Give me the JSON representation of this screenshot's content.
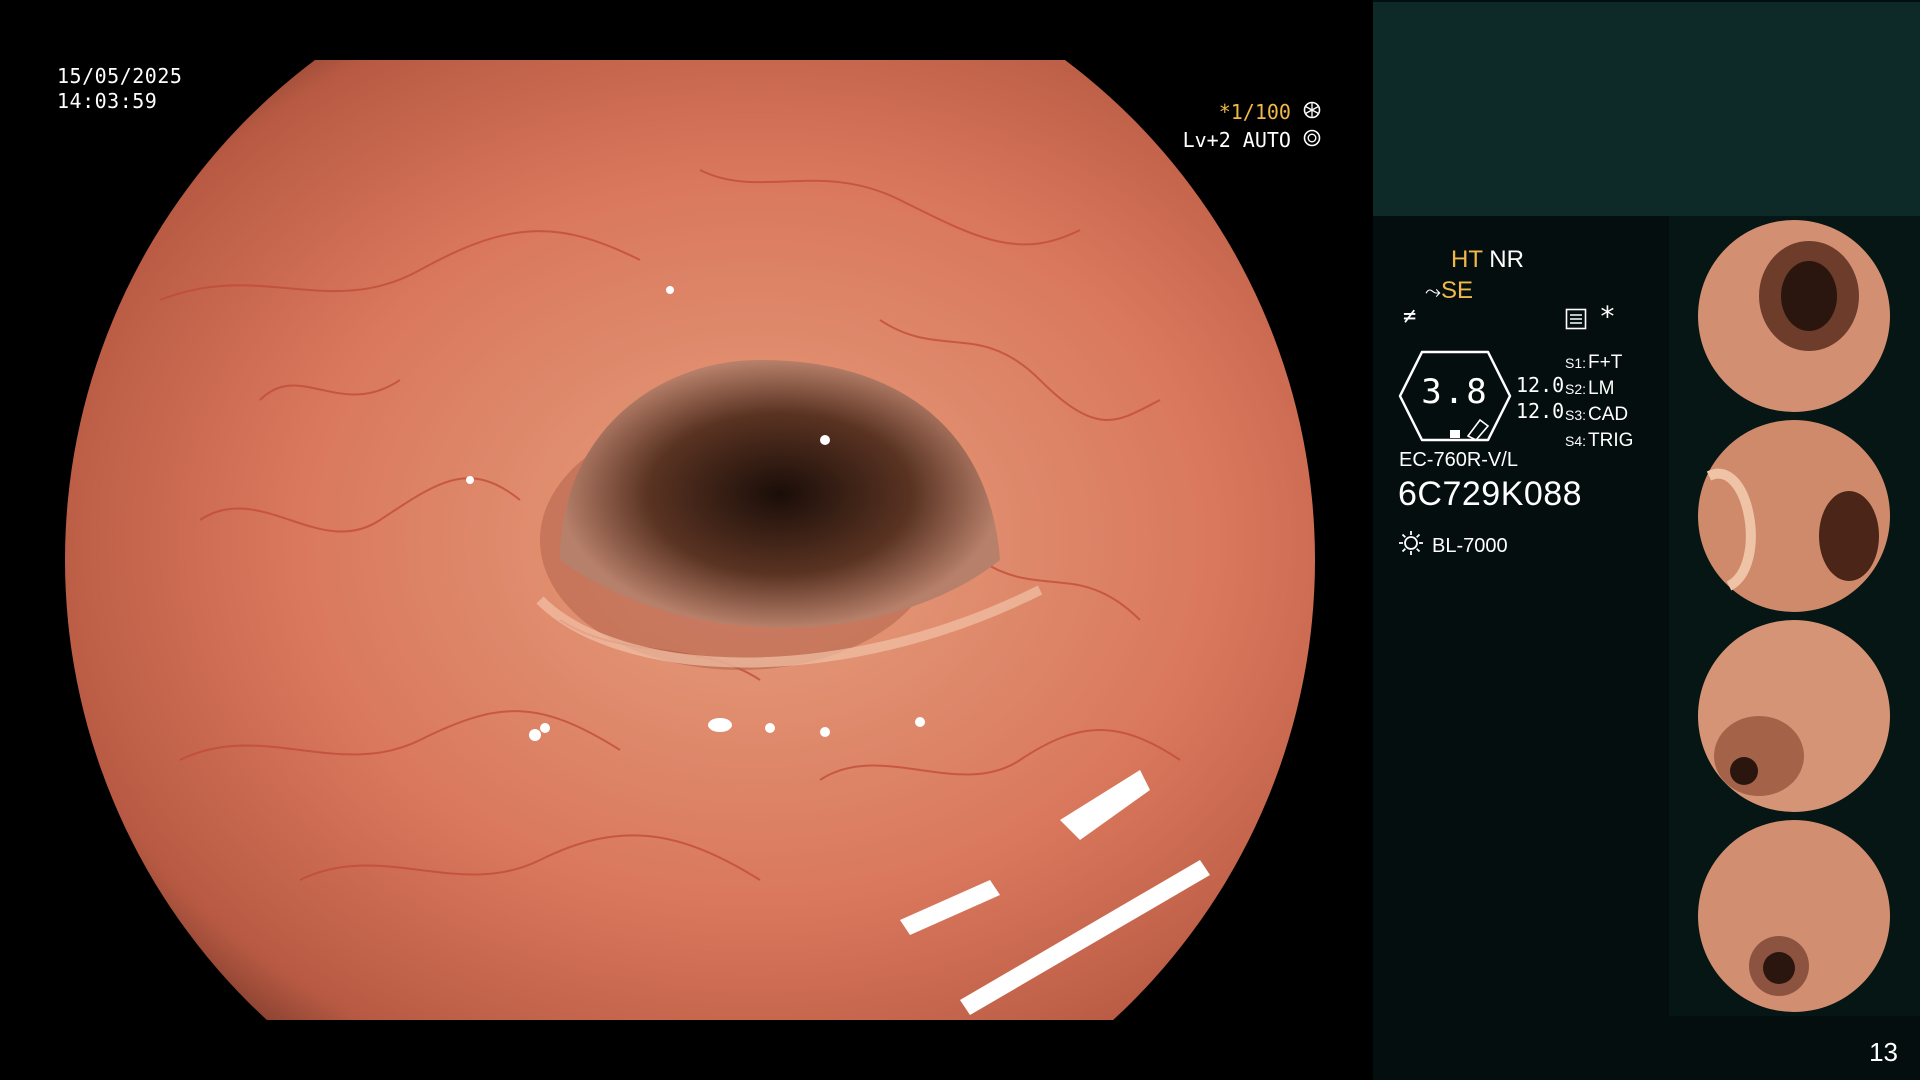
{
  "video": {
    "date": "15/05/2025",
    "time": "14:03:59",
    "shutter": "*1/100",
    "level_mode": "Lv+2 AUTO"
  },
  "panel": {
    "mode_ht": "HT",
    "mode_nr": "NR",
    "mode_se": "SE",
    "gauge_value": "3.8",
    "gauge_sub_1": "12.0",
    "gauge_sub_2": "12.0",
    "settings": [
      {
        "key": "S1:",
        "value": "F+T"
      },
      {
        "key": "S2:",
        "value": "LM"
      },
      {
        "key": "S3:",
        "value": "CAD"
      },
      {
        "key": "S4:",
        "value": "TRIG"
      }
    ],
    "scope_model": "EC-760R-V/L",
    "serial": "6C729K088",
    "light_source": "BL-7000",
    "page_number": "13"
  },
  "colors": {
    "accent": "#f0b84a",
    "panel_top": "#0d2a29",
    "panel_bg": "#050e0e"
  },
  "icons": {
    "shutter": "aperture-icon",
    "auto": "iris-icon",
    "light": "sun-icon",
    "freeze": "capture-icon",
    "asterisk": "asterisk-icon"
  }
}
